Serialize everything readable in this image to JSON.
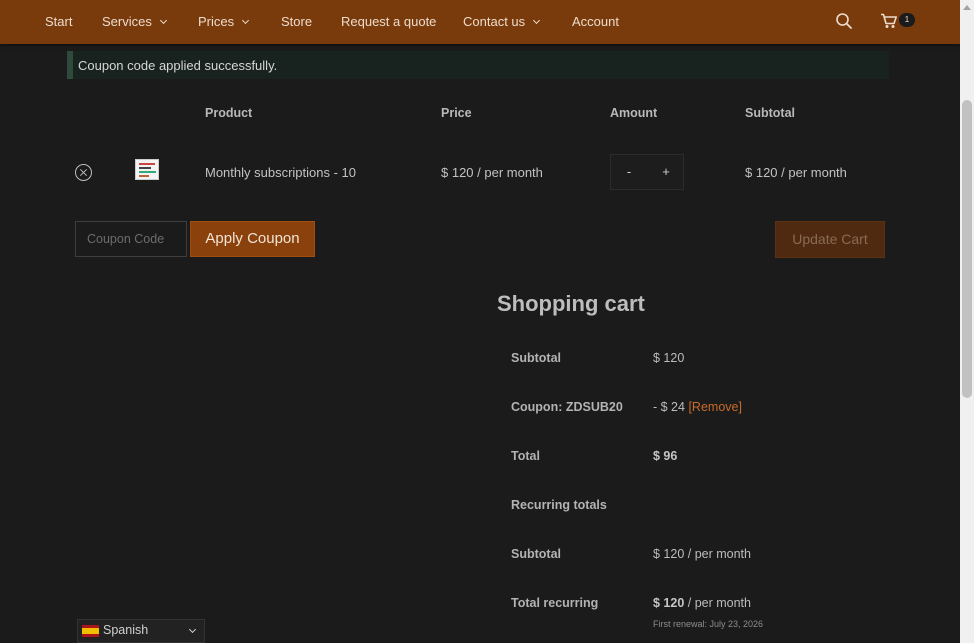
{
  "nav": {
    "items": [
      {
        "label": "Start"
      },
      {
        "label": "Services"
      },
      {
        "label": "Prices"
      },
      {
        "label": "Store"
      },
      {
        "label": "Request a quote"
      },
      {
        "label": "Contact us"
      },
      {
        "label": "Account"
      }
    ],
    "cart_count": "1",
    "search_icon": "search-icon",
    "cart_icon": "cart-icon",
    "bar_color": "#7a3b0c"
  },
  "notice": {
    "message": "Coupon code applied successfully."
  },
  "cart_table": {
    "headers": {
      "product": "Product",
      "price": "Price",
      "amount": "Amount",
      "subtotal": "Subtotal"
    },
    "rows": [
      {
        "product": "Monthly subscriptions - 10",
        "price": "$ 120 / per month",
        "qty_minus": "-",
        "qty_plus": "+",
        "subtotal": "$ 120 / per month"
      }
    ]
  },
  "coupon": {
    "placeholder": "Coupon Code",
    "apply_label": "Apply Coupon",
    "update_label": "Update Cart"
  },
  "totals": {
    "title": "Shopping cart",
    "subtotal_label": "Subtotal",
    "subtotal_value": "$ 120",
    "coupon_label": "Coupon: ZDSUB20",
    "coupon_value": "- $ 24",
    "coupon_remove": "[Remove]",
    "total_label": "Total",
    "total_value": "$ 96",
    "recurring_heading": "Recurring totals",
    "recurring_subtotal_label": "Subtotal",
    "recurring_subtotal_value": "$ 120 / per month",
    "total_recurring_label": "Total recurring",
    "total_recurring_amount": "$ 120",
    "total_recurring_period": " / per month",
    "first_renewal": "First renewal: July 23, 2026"
  },
  "language": {
    "label": "Spanish",
    "flag_icon": "spain-flag-icon"
  },
  "colors": {
    "accent": "#8a410b",
    "background": "#1b1b1b",
    "link": "#c86b2a"
  }
}
